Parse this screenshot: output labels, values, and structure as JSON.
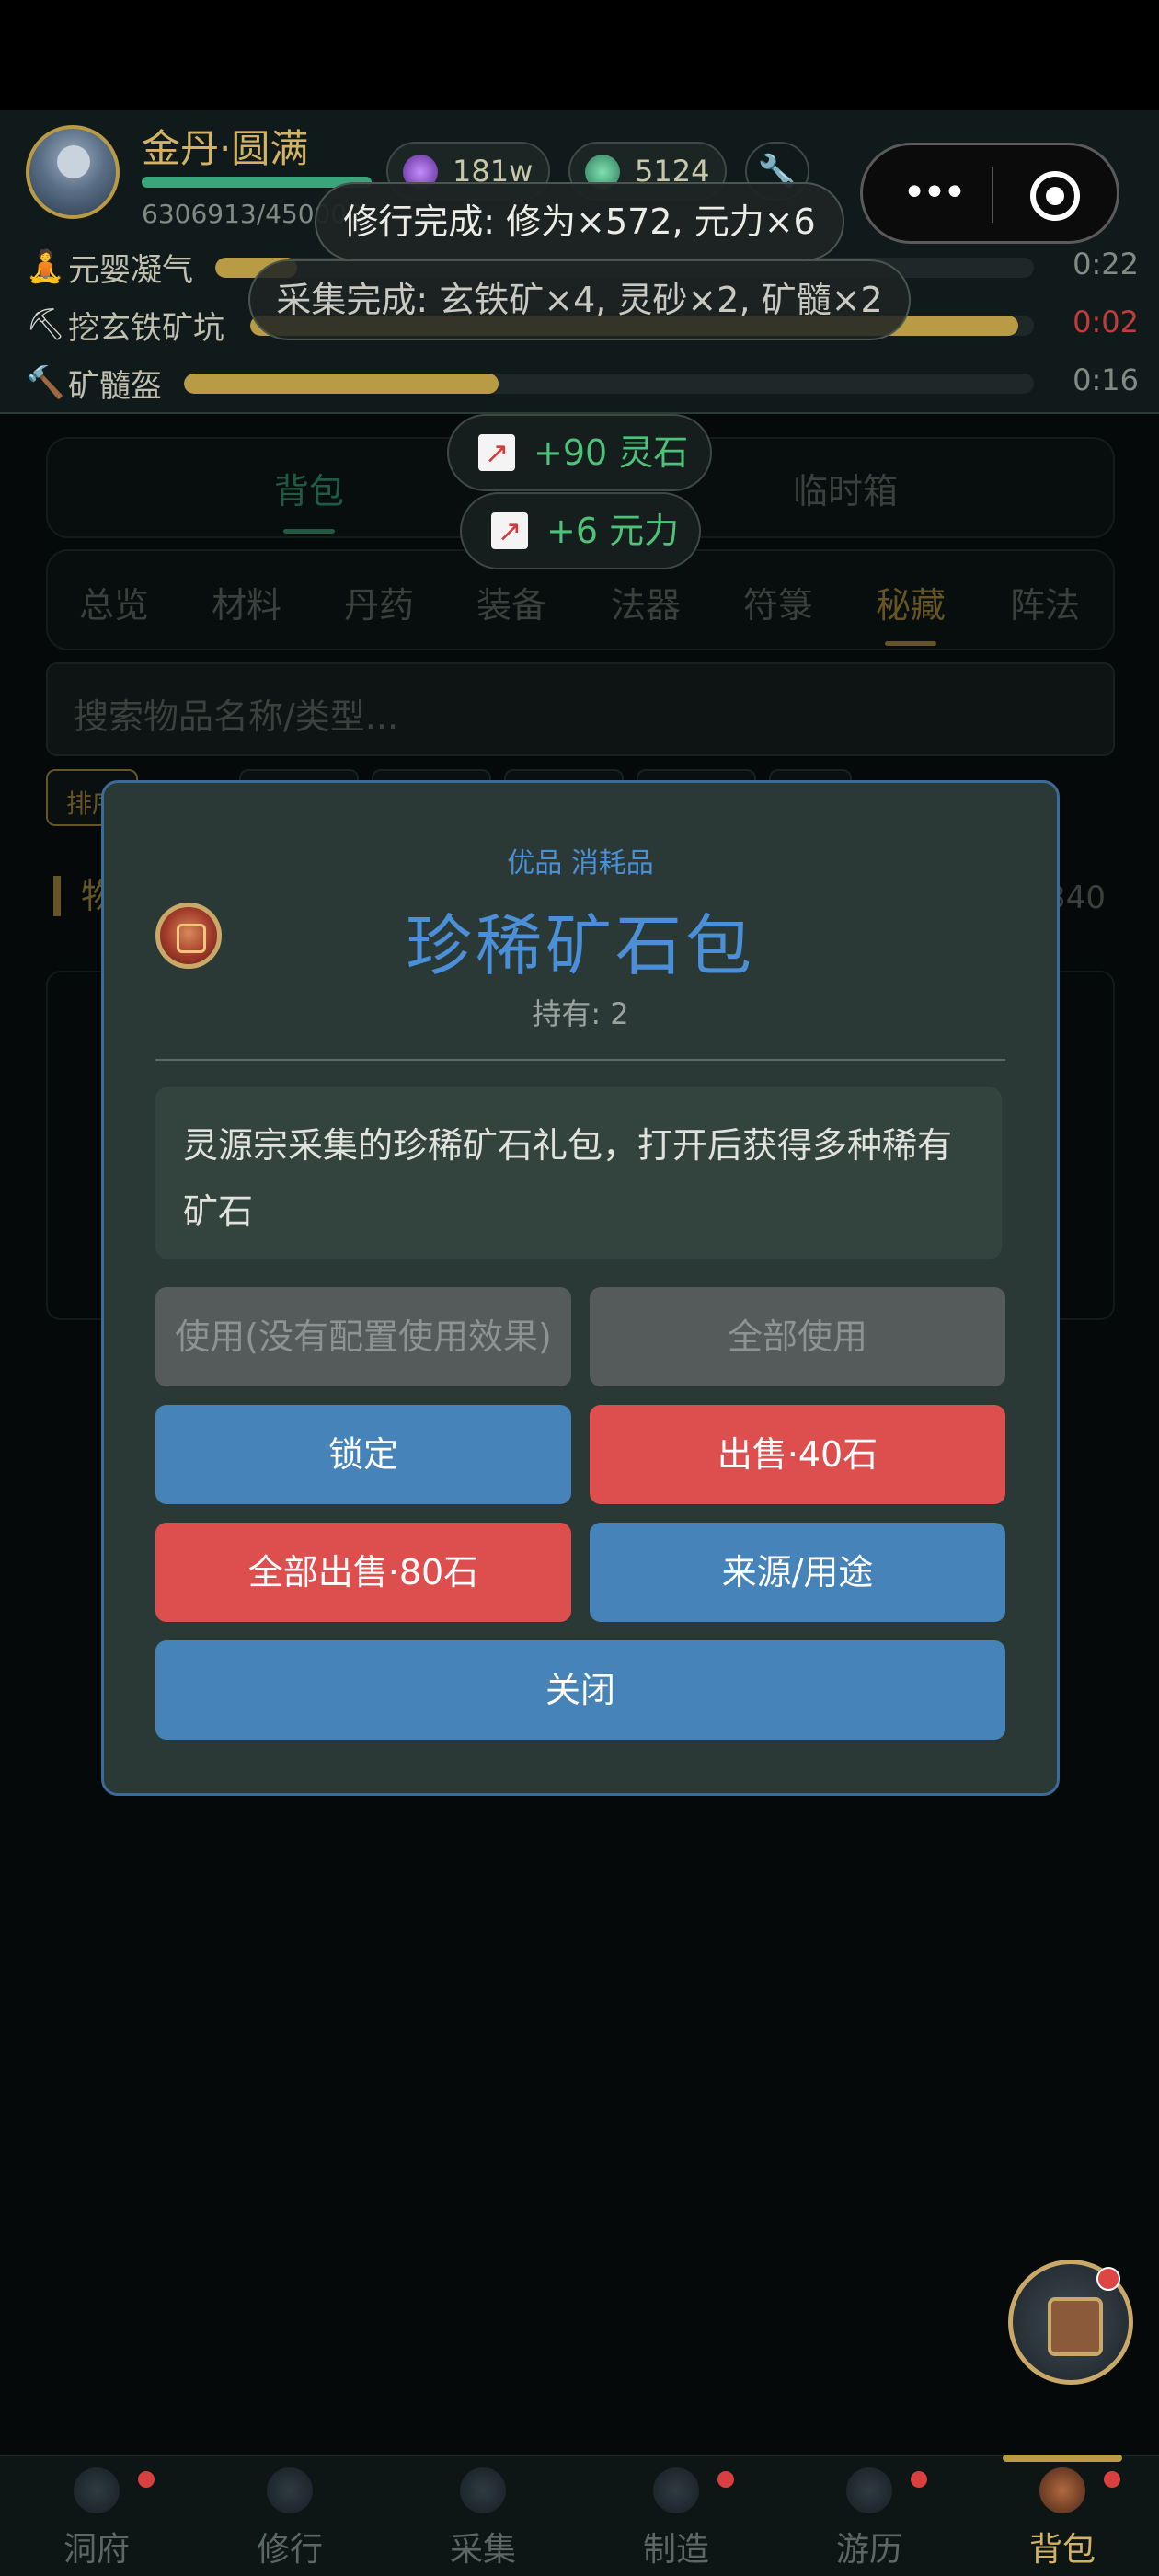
{
  "header": {
    "rank": "金丹·圆满",
    "exp": "6306913/450000",
    "resource1": "181w",
    "resource2": "5124",
    "tasks": [
      {
        "label": "元婴凝气",
        "time": "0:22",
        "progress": 0.1
      },
      {
        "label": "挖玄铁矿坑",
        "time": "0:02",
        "progress": 0.98
      },
      {
        "label": "矿髓盔",
        "time": "0:16",
        "progress": 0.37
      }
    ]
  },
  "toasts": {
    "cultivate": "修行完成: 修为×572, 元力×6",
    "gather": "采集完成: 玄铁矿×4, 灵砂×2, 矿髓×2",
    "gain1": "+90 灵石",
    "gain2": "+6 元力"
  },
  "tabs": [
    "背包",
    "临时箱"
  ],
  "categories": [
    "总览",
    "材料",
    "丹药",
    "装备",
    "法器",
    "符箓",
    "秘藏",
    "阵法"
  ],
  "active_category": "秘藏",
  "search": {
    "placeholder": "搜索物品名称/类型..."
  },
  "filters": {
    "first": "排序"
  },
  "section": {
    "title": "物品",
    "count": "340"
  },
  "modal": {
    "tag": "优品 消耗品",
    "title": "珍稀矿石包",
    "holding": "持有: 2",
    "description": "灵源宗采集的珍稀矿石礼包，打开后获得多种稀有矿石",
    "buttons": {
      "use": "使用(没有配置使用效果)",
      "use_all": "全部使用",
      "lock": "锁定",
      "sell": "出售·40石",
      "sell_all": "全部出售·80石",
      "source": "来源/用途",
      "close": "关闭"
    }
  },
  "nav": [
    "洞府",
    "修行",
    "采集",
    "制造",
    "游历",
    "背包"
  ],
  "nav_active": "背包"
}
